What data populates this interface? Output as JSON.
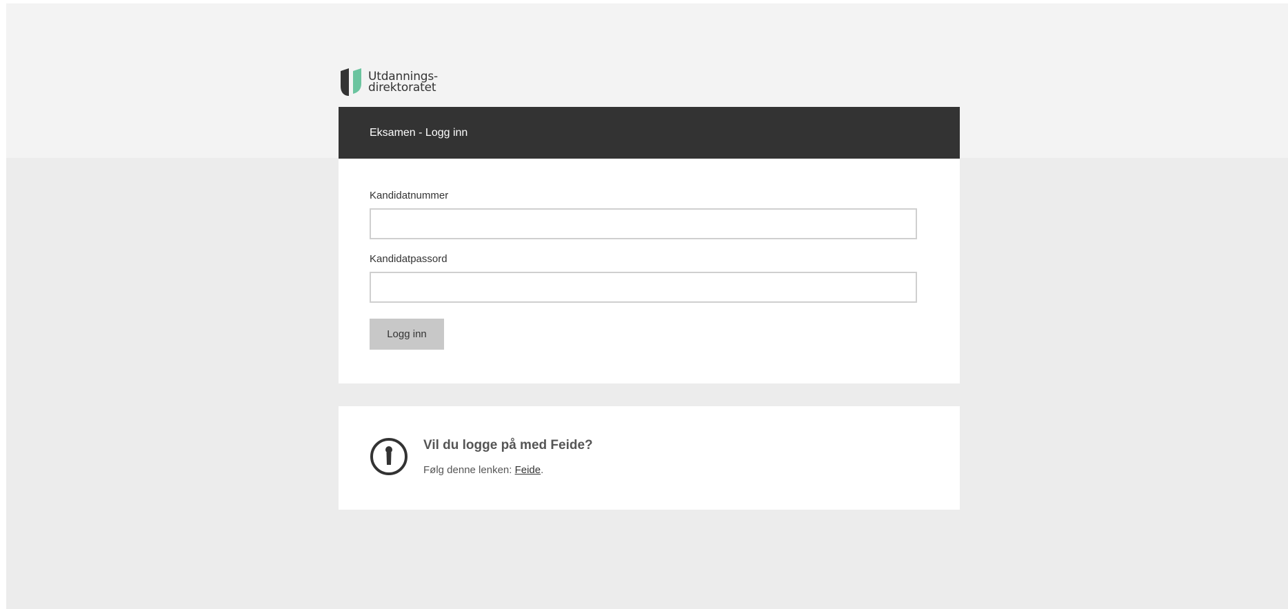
{
  "logo": {
    "line1": "Utdannings-",
    "line2": "direktoratet",
    "icon": "udir-logo-icon",
    "colors": {
      "dark": "#333333",
      "green": "#6bc49f"
    }
  },
  "login_card": {
    "header_title": "Eksamen - Logg inn",
    "candidate_number_label": "Kandidatnummer",
    "candidate_number_value": "",
    "candidate_password_label": "Kandidatpassord",
    "candidate_password_value": "",
    "submit_label": "Logg inn"
  },
  "feide_card": {
    "icon": "keyhole-info-icon",
    "title": "Vil du logge på med Feide?",
    "prefix": "Følg denne lenken: ",
    "link_text": "Feide",
    "suffix": "."
  },
  "colors": {
    "header_bg": "#333333",
    "page_bg": "#ececec",
    "top_band_bg": "#f3f3f3",
    "button_bg": "#c8c8c8"
  }
}
